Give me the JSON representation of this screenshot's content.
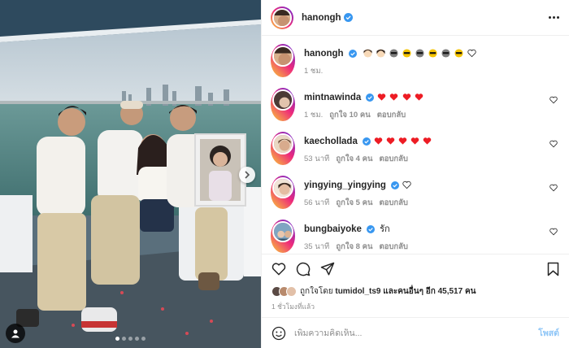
{
  "post": {
    "author": "hanongh",
    "caption_time": "1 ชม.",
    "more_label": "More options",
    "images": {
      "count": 5,
      "active": 0
    }
  },
  "colors": {
    "verified": "#3897f0",
    "heart_red": "#ed4956",
    "muted_text": "#8e8e8e",
    "post_button": "#8fc6f7"
  },
  "comments": [
    {
      "user": "mintnawinda",
      "verified": true,
      "text": "",
      "emoji": [
        "red-heart",
        "red-heart",
        "red-heart",
        "red-heart"
      ],
      "time": "1 ชม.",
      "likes": "ถูกใจ 10 คน",
      "reply": "ตอบกลับ"
    },
    {
      "user": "kaechollada",
      "verified": true,
      "text": "",
      "emoji": [
        "red-heart",
        "red-heart",
        "red-heart",
        "red-heart",
        "red-heart"
      ],
      "time": "53 นาที",
      "likes": "ถูกใจ 4 คน",
      "reply": "ตอบกลับ"
    },
    {
      "user": "yingying_yingying",
      "verified": true,
      "text": "",
      "emoji": [
        "white-heart"
      ],
      "time": "56 นาที",
      "likes": "ถูกใจ 5 คน",
      "reply": "ตอบกลับ"
    },
    {
      "user": "bungbaiyoke",
      "verified": true,
      "text": "รัก",
      "emoji": [],
      "time": "35 นาที",
      "likes": "ถูกใจ 8 คน",
      "reply": "ตอบกลับ"
    }
  ],
  "likes_summary": {
    "prefix": "ถูกใจโดย",
    "user": "tumidol_ts9",
    "middle": "และคนอื่นๆ อีก",
    "count": "45,517",
    "suffix": "คน"
  },
  "posted_ago": "1 ชั่วโมงที่แล้ว",
  "comment_box": {
    "placeholder": "เพิ่มความคิดเห็น...",
    "post_label": "โพสต์"
  }
}
